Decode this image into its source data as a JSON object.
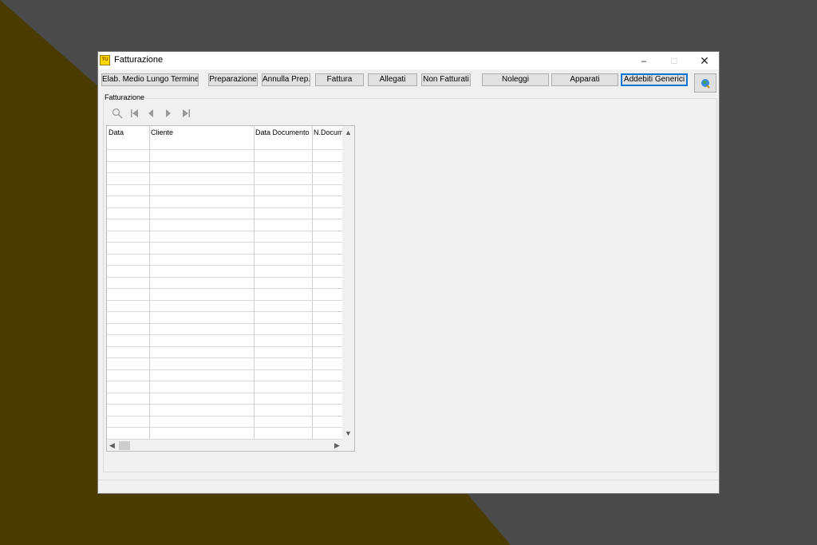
{
  "window": {
    "title": "Fatturazione",
    "icon_text": "TU",
    "controls": {
      "minimize": "–",
      "maximize": "□",
      "close": "✕"
    }
  },
  "toolbar": {
    "buttons": [
      "Elab. Medio Lungo Termine",
      "Preparazione",
      "Annulla Prep.",
      "Fattura",
      "Allegati",
      "Non Fatturati",
      "Noleggi",
      "Apparati",
      "Addebiti Generici"
    ],
    "extra_icon": "globe-icon"
  },
  "group": {
    "label": "Fatturazione",
    "nav": {
      "search": "search-icon",
      "first": "first-icon",
      "prev": "prev-icon",
      "next": "next-icon",
      "last": "last-icon"
    }
  },
  "grid": {
    "columns": [
      "Data",
      "Cliente",
      "Data Documento",
      "N.Docum"
    ],
    "rows": []
  },
  "colors": {
    "desktop": "#4a4a4a",
    "accent_focus": "#0078d7",
    "wallpaper_shape": "#4a3a00"
  }
}
